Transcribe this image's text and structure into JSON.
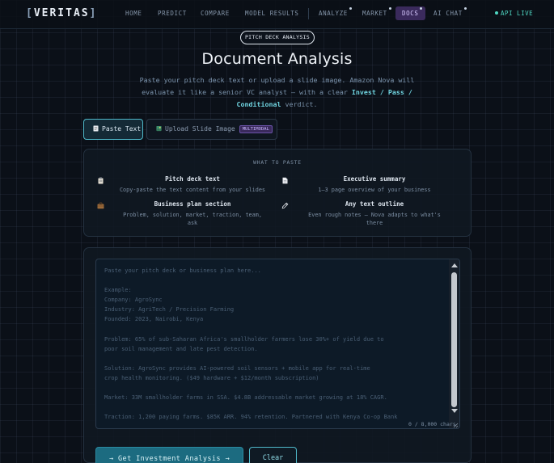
{
  "nav": {
    "logo": "VERITAS",
    "items": [
      {
        "label": "HOME"
      },
      {
        "label": "PREDICT"
      },
      {
        "label": "COMPARE"
      },
      {
        "label": "MODEL RESULTS"
      },
      {
        "label": "ANALYZE"
      },
      {
        "label": "MARKET"
      },
      {
        "label": "DOCS"
      },
      {
        "label": "AI CHAT"
      }
    ],
    "active": "DOCS",
    "status": "API LIVE"
  },
  "header": {
    "badge": "PITCH DECK ANALYSIS",
    "title": "Document Analysis",
    "subtitle_part1": "Paste your pitch deck text or upload a slide image. Amazon Nova will evaluate it like a senior VC analyst — with a clear ",
    "subtitle_highlight": "Invest / Pass / Conditional",
    "subtitle_part2": " verdict."
  },
  "tabs": {
    "paste": "Paste Text",
    "upload": "Upload Slide Image",
    "upload_badge": "MULTIMODAL"
  },
  "guide": {
    "title": "WHAT TO PASTE",
    "items": [
      {
        "icon": "clipboard-icon",
        "title": "Pitch deck text",
        "desc": "Copy-paste the text content from your slides"
      },
      {
        "icon": "document-icon",
        "title": "Executive summary",
        "desc": "1–3 page overview of your business"
      },
      {
        "icon": "briefcase-icon",
        "title": "Business plan section",
        "desc": "Problem, solution, market, traction, team,",
        "desc2": "ask"
      },
      {
        "icon": "pencil-icon",
        "title": "Any text outline",
        "desc": "Even rough notes — Nova adapts to what's",
        "desc2": "there"
      }
    ]
  },
  "input": {
    "placeholder_lines": [
      "Paste your pitch deck or business plan here...",
      "",
      "Example:",
      "Company: AgroSync",
      "Industry: AgriTech / Precision Farming",
      "Founded: 2023, Nairobi, Kenya",
      "",
      "Problem: 65% of sub-Saharan Africa's smallholder farmers lose 30%+ of yield due to",
      "poor soil management and late pest detection.",
      "",
      "Solution: AgroSync provides AI-powered soil sensors + mobile app for real-time",
      "crop health monitoring. ($49 hardware + $12/month subscription)",
      "",
      "Market: 33M smallholder farms in SSA. $4.8B addressable market growing at 18% CAGR.",
      "",
      "Traction: 1,200 paying farms. $85K ARR. 94% retention. Partnered with Kenya Co-op Bank"
    ],
    "counter": "0 / 8,000 chars"
  },
  "actions": {
    "analyze": "→ Get Investment Analysis →",
    "clear": "Clear"
  },
  "colors": {
    "accent": "#4fb8c9",
    "active_tab": "#3a2a5c",
    "live": "#4fd6c2"
  }
}
